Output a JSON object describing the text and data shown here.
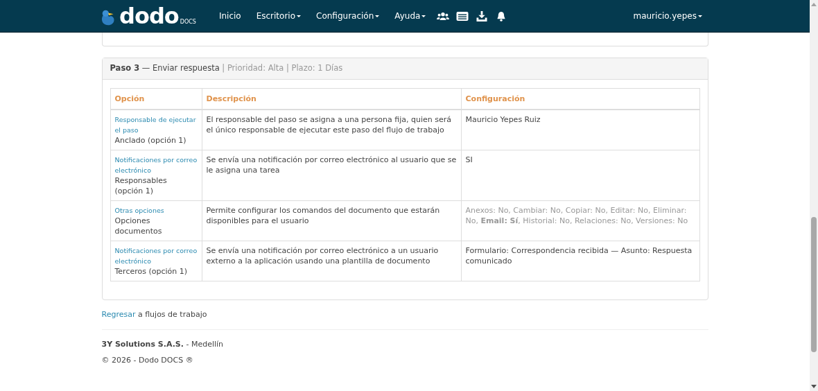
{
  "navbar": {
    "logo": {
      "text": "dodo",
      "sub": "DOCS"
    },
    "items": [
      {
        "label": "Inicio",
        "dropdown": false
      },
      {
        "label": "Escritorio",
        "dropdown": true
      },
      {
        "label": "Configuración",
        "dropdown": true
      },
      {
        "label": "Ayuda",
        "dropdown": true
      }
    ],
    "icons": [
      {
        "kind": "users"
      },
      {
        "kind": "card"
      },
      {
        "kind": "download"
      },
      {
        "kind": "bell"
      }
    ],
    "user": {
      "label": "mauricio.yepes",
      "dropdown": true
    }
  },
  "step": {
    "title": "**Paso 3** — Enviar respuesta",
    "meta": " | Prioridad: Alta | Plazo: 1 Días",
    "table": {
      "columns": [
        "Opción",
        "Descripción",
        "Configuración"
      ],
      "rows": [
        {
          "option_link": "Responsable de ejecutar el paso",
          "option_value": "Anclado (opción 1)",
          "description": "El responsable del paso se asigna a una persona fija, quien será el único responsable de ejecutar este paso del flujo de trabajo",
          "configuration": "Mauricio Yepes Ruiz",
          "muted": false
        },
        {
          "option_link": "Notificaciones por correo electrónico",
          "option_value": "Responsables (opción 1)",
          "description": "Se envía una notificación por correo electrónico al usuario que se le asigna una tarea",
          "configuration": "SI",
          "muted": false
        },
        {
          "option_link": "Otras opciones",
          "option_value": "Opciones documentos",
          "description": "Permite configurar los comandos del documento que estarán disponibles para el usuario",
          "configuration": "Anexos: No, Cambiar: No, Copiar: No, Editar: No, Eliminar: No, **Email: Sí**, Historial: No, Relaciones: No, Versiones: No",
          "muted": true
        },
        {
          "option_link": "Notificaciones por correo electrónico",
          "option_value": "Terceros (opción 1)",
          "description": "Se envía una notificación por correo electrónico a un usuario externo a la aplicación usando una plantilla de documento",
          "configuration": "Formulario: Correspondencia recibida — Asunto: Respuesta comunicado",
          "muted": false
        }
      ]
    }
  },
  "back": {
    "link": "Regresar",
    "text": " a flujos de trabajo"
  },
  "footer": {
    "company": "**3Y Solutions S.A.S.** - Medellín",
    "copyright": "© 2026 - Dodo DOCS ®"
  }
}
